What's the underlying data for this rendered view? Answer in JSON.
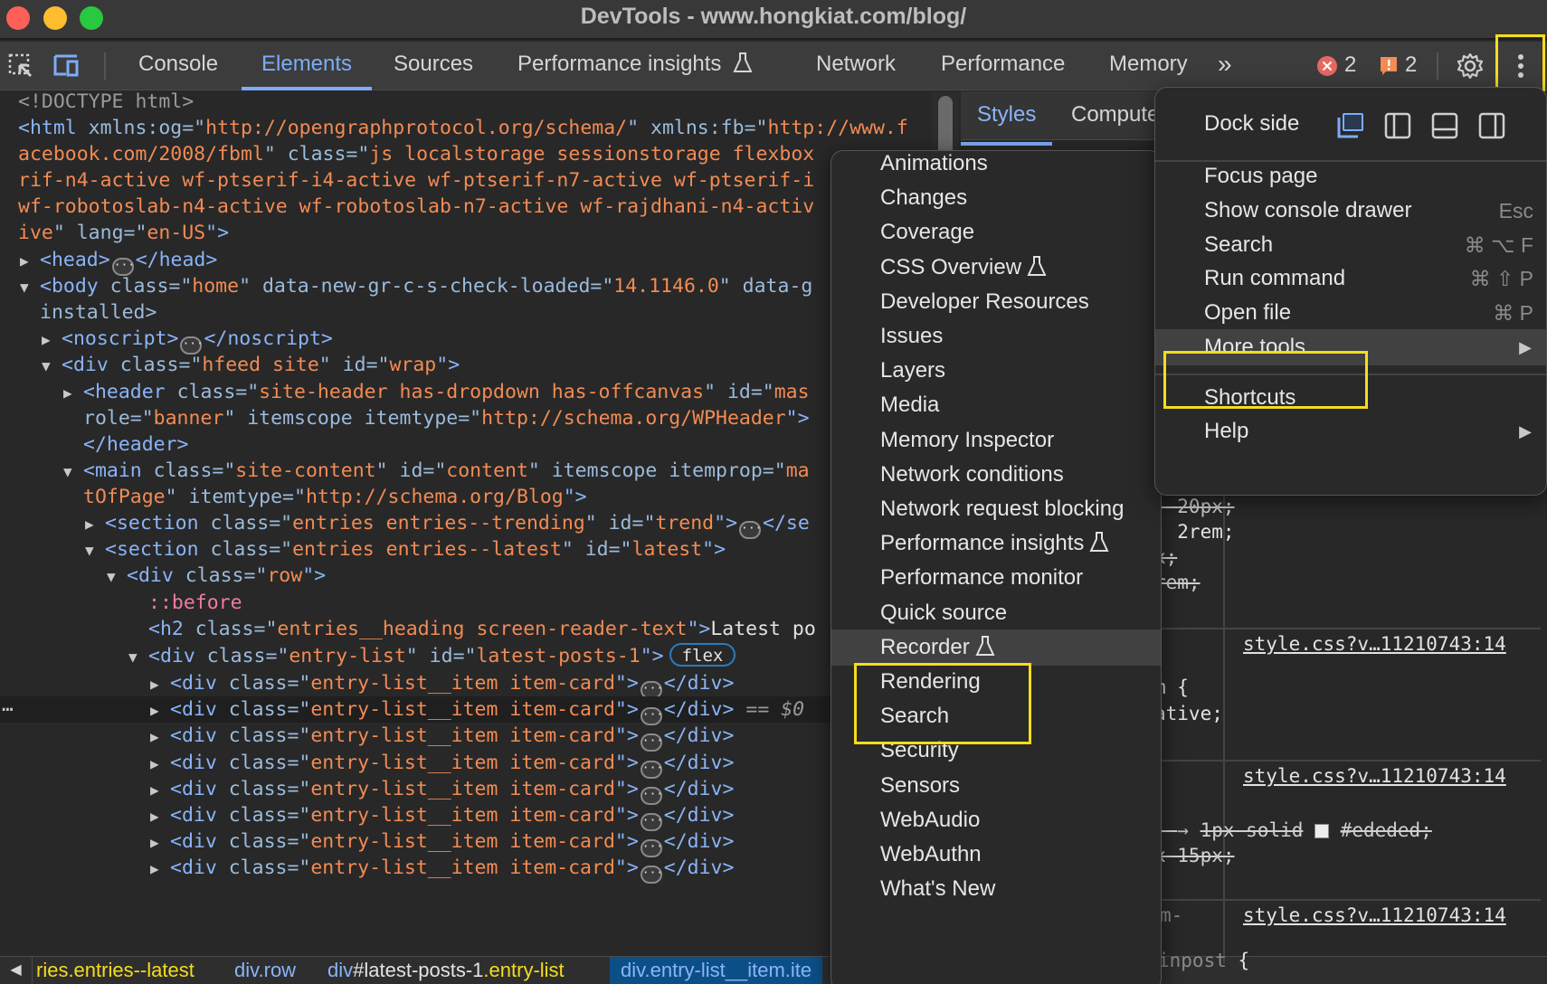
{
  "window": {
    "title": "DevTools - www.hongkiat.com/blog/"
  },
  "toolbar": {
    "inspect_icon": "select-element-icon",
    "device_icon": "device-toolbar-icon",
    "tabs": [
      {
        "label": "Console",
        "active": false
      },
      {
        "label": "Elements",
        "active": true
      },
      {
        "label": "Sources",
        "active": false
      },
      {
        "label": "Performance insights",
        "active": false,
        "experimental": true
      },
      {
        "label": "Network",
        "active": false
      },
      {
        "label": "Performance",
        "active": false
      },
      {
        "label": "Memory",
        "active": false
      }
    ],
    "overflow_label": "»",
    "error_count": "2",
    "warning_count": "2",
    "settings_icon": "gear-icon",
    "menu_icon": "kebab-menu-icon"
  },
  "elements": {
    "lines": [
      "<!DOCTYPE html>",
      "xmlns:og",
      "http://opengraphprotocol.org/schema/",
      "xmlns:fb",
      "http://www.f",
      "acebook.com/2008/fbml",
      "js localstorage sessionstorage flexbox",
      "rif-n4-active wf-ptserif-i4-active wf-ptserif-n7-active wf-ptserif-i",
      "wf-robotoslab-n4-active wf-robotoslab-n7-active wf-rajdhani-n4-activ",
      "ive",
      "en-US"
    ],
    "head": "head",
    "body_class": "home",
    "body_attr": "data-new-gr-c-s-check-loaded",
    "body_attr_val": "14.1146.0",
    "body_attr2": "data-g",
    "body_cont": "installed>",
    "noscript": "noscript",
    "div_wrap_class": "hfeed site",
    "div_wrap_id": "wrap",
    "header_class": "site-header has-dropdown has-offcanvas",
    "header_id_partial": "mas",
    "header_role": "banner",
    "header_itemtype": "http://schema.org/WPHeader",
    "main_class": "site-content",
    "main_id": "content",
    "main_itemprop_partial": "ma",
    "main_cont": "tOfPage",
    "main_itemtype": "http://schema.org/Blog",
    "section1_class": "entries entries--trending",
    "section1_id": "trend",
    "section2_class": "entries entries--latest",
    "section2_id": "latest",
    "row_class": "row",
    "pseudo_before": "::before",
    "h2_class": "entries__heading screen-reader-text",
    "h2_text": "Latest po",
    "entry_list_class": "entry-list",
    "entry_list_id": "latest-posts-1",
    "flex_badge": "flex",
    "item_class": "entry-list__item item-card",
    "selected_marker": "== $0",
    "item_count": 8,
    "selected_index": 1
  },
  "breadcrumb": {
    "items": [
      {
        "tag": "",
        "rest": "ries.entries--latest"
      },
      {
        "tag": "div",
        "rest": ".row"
      },
      {
        "tag": "div",
        "id": "#latest-posts-1",
        "rest": ".entry-list"
      },
      {
        "tag": "div",
        "rest": ".entry-list__item.ite",
        "active": true
      }
    ]
  },
  "styles": {
    "tabs": [
      {
        "label": "Styles",
        "active": true
      },
      {
        "label": "Compute",
        "active": false
      }
    ],
    "lines": {
      "l1": "- 20px;",
      "l2": ": 2rem;",
      "l3": "x;",
      "l4": "rem;",
      "link": "style.css?v…11210743:14",
      "l5": "m {",
      "l6": "ative;",
      "l7a": "1px solid",
      "l7b": "#ededed;",
      "l8": "x 15px;",
      "l9": "m-",
      "l10a": "inpost",
      "l10b": " {"
    }
  },
  "main_menu": {
    "dock_label": "Dock side",
    "dock_options": [
      {
        "name": "undock",
        "active": true
      },
      {
        "name": "dock-left",
        "active": false
      },
      {
        "name": "dock-bottom",
        "active": false
      },
      {
        "name": "dock-right",
        "active": false
      }
    ],
    "items": [
      {
        "label": "Focus page",
        "shortcut": ""
      },
      {
        "label": "Show console drawer",
        "shortcut": "Esc"
      },
      {
        "label": "Search",
        "shortcut": "⌘ ⌥ F"
      },
      {
        "label": "Run command",
        "shortcut": "⌘ ⇧ P"
      },
      {
        "label": "Open file",
        "shortcut": "⌘ P"
      },
      {
        "label": "More tools",
        "submenu": true,
        "hover": true
      },
      {
        "label": "Shortcuts",
        "shortcut": ""
      },
      {
        "label": "Help",
        "submenu": true
      }
    ]
  },
  "more_tools_menu": {
    "items": [
      {
        "label": "Animations"
      },
      {
        "label": "Changes"
      },
      {
        "label": "Coverage"
      },
      {
        "label": "CSS Overview",
        "experimental": true
      },
      {
        "label": "Developer Resources"
      },
      {
        "label": "Issues"
      },
      {
        "label": "Layers"
      },
      {
        "label": "Media"
      },
      {
        "label": "Memory Inspector"
      },
      {
        "label": "Network conditions"
      },
      {
        "label": "Network request blocking"
      },
      {
        "label": "Performance insights",
        "experimental": true
      },
      {
        "label": "Performance monitor"
      },
      {
        "label": "Quick source"
      },
      {
        "label": "Recorder",
        "experimental": true,
        "hover": true
      },
      {
        "label": "Rendering"
      },
      {
        "label": "Search"
      },
      {
        "label": "Security"
      },
      {
        "label": "Sensors"
      },
      {
        "label": "WebAudio"
      },
      {
        "label": "WebAuthn"
      },
      {
        "label": "What's New"
      }
    ]
  },
  "colors": {
    "accent": "#7cacf8",
    "highlight": "#f5dc1f",
    "error": "#e46962",
    "warning": "#f28b54"
  }
}
